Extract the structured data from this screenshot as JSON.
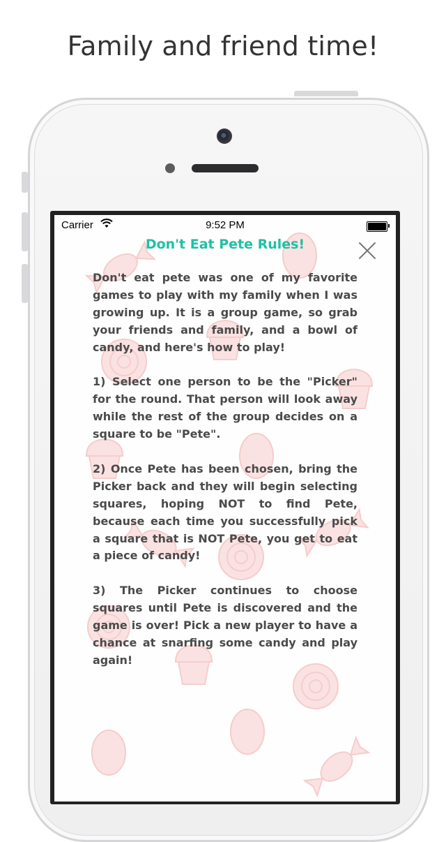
{
  "headline": "Family and friend time!",
  "status_bar": {
    "carrier": "Carrier",
    "time": "9:52 PM"
  },
  "modal": {
    "title": "Don't Eat Pete Rules!",
    "close_icon": "close-icon",
    "paragraphs": [
      "Don't eat pete was one of my favorite games to play with my family when I was growing up. It is a group game, so grab your friends and family, and a bowl of candy, and here's how to play!",
      "1) Select one person to be the \"Picker\" for the round. That person will look away while the rest of the group decides on a square to be \"Pete\".",
      "2) Once Pete has been chosen, bring the Picker back and they will begin selecting squares, hoping NOT to find Pete, because each time you successfully pick a square that is NOT Pete, you get to eat a piece of candy!",
      "3) The Picker continues to choose squares until Pete is discovered and the game is over! Pick a new player to have a chance at snarfing some candy and play again!"
    ]
  },
  "colors": {
    "title": "#20c0a6",
    "body_text": "#4a4a4a",
    "candy_pattern": "#f8d6d6"
  }
}
